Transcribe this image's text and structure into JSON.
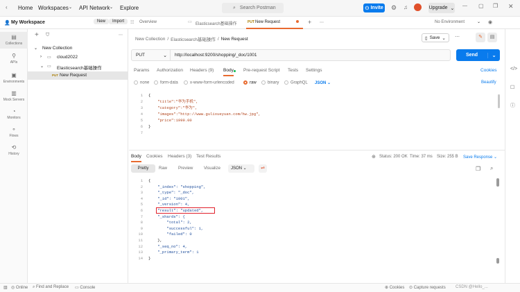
{
  "topbar": {
    "home": "Home",
    "workspaces": "Workspaces",
    "api_network": "API Network",
    "explore": "Explore",
    "search_placeholder": "Search Postman",
    "invite": "Invite",
    "upgrade": "Upgrade"
  },
  "workspace": {
    "name": "My Workspace",
    "new": "New",
    "import": "Import"
  },
  "tabs": [
    {
      "label": "Overview"
    },
    {
      "label": "Elasticsearch基础操作"
    },
    {
      "method": "PUT",
      "label": "New Request"
    }
  ],
  "environment": "No Environment",
  "rail": [
    "Collections",
    "APIs",
    "Environments",
    "Mock Servers",
    "Monitors",
    "Flows",
    "History"
  ],
  "sidebar": {
    "root": "New Collection",
    "items": [
      "cloud2022",
      "Elasticsearch基础操作"
    ],
    "request_method": "PUT",
    "request": "New Request"
  },
  "breadcrumb": {
    "a": "New Collection",
    "b": "Elasticsearch基础操作",
    "c": "New Request"
  },
  "save": "Save",
  "request": {
    "method": "PUT",
    "url": "http://localhost:9200/shopping/_doc/1001",
    "send": "Send"
  },
  "req_tabs": [
    "Params",
    "Authorization",
    "Headers (9)",
    "Body",
    "Pre-request Script",
    "Tests",
    "Settings"
  ],
  "cookies": "Cookies",
  "beautify": "Beautify",
  "body_modes": [
    "none",
    "form-data",
    "x-www-form-urlencoded",
    "raw",
    "binary",
    "GraphQL"
  ],
  "body_format": "JSON",
  "request_body": [
    "{",
    "    \"title\":\"华为手机\",",
    "    \"category\":\"华为\",",
    "    \"images\":\"http://www.gulixueyuan.com/hw.jpg\",",
    "    \"price\":1999.00",
    "}",
    ""
  ],
  "resp_tabs": [
    "Body",
    "Cookies",
    "Headers (3)",
    "Test Results"
  ],
  "resp_status": {
    "status": "Status: 200 OK",
    "time": "Time: 37 ms",
    "size": "Size: 255 B",
    "save": "Save Response"
  },
  "resp_views": [
    "Pretty",
    "Raw",
    "Preview",
    "Visualize"
  ],
  "resp_format": "JSON",
  "response_body": [
    "{",
    "    \"_index\": \"shopping\",",
    "    \"_type\": \"_doc\",",
    "    \"_id\": \"1001\",",
    "    \"_version\": 4,",
    "    \"result\": \"updated\",",
    "    \"_shards\": {",
    "        \"total\": 2,",
    "        \"successful\": 1,",
    "        \"failed\": 0",
    "    },",
    "    \"_seq_no\": 4,",
    "    \"_primary_term\": 1",
    "}"
  ],
  "statusbar": {
    "online": "Online",
    "find": "Find and Replace",
    "console": "Console",
    "cookies": "Cookies",
    "capture": "Capture requests",
    "watermark": "CSDN @Hello_..."
  },
  "colors": {
    "accent": "#097bed",
    "put": "#a97c00",
    "highlight": "#e0202a"
  }
}
